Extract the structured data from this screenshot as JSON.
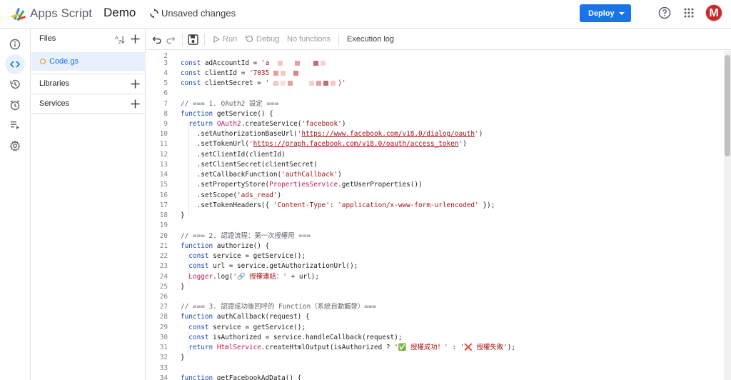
{
  "header": {
    "app_name": "Apps Script",
    "project_name": "Demo",
    "status": "Unsaved changes",
    "deploy_label": "Deploy",
    "avatar_letter": "M",
    "accent": "#1a73e8"
  },
  "rail": {
    "items": [
      {
        "name": "overview",
        "icon": "info-icon"
      },
      {
        "name": "editor",
        "icon": "code-icon",
        "active": true
      },
      {
        "name": "triggers-history",
        "icon": "history-icon"
      },
      {
        "name": "triggers",
        "icon": "alarm-icon"
      },
      {
        "name": "executions",
        "icon": "executions-icon"
      },
      {
        "name": "settings",
        "icon": "gear-icon"
      }
    ]
  },
  "files_panel": {
    "files_title": "Files",
    "file_name": "Code.gs",
    "libraries_title": "Libraries",
    "services_title": "Services"
  },
  "toolbar": {
    "run_label": "Run",
    "debug_label": "Debug",
    "function_select": "No functions",
    "execution_log_label": "Execution log"
  },
  "code": {
    "lines": [
      {
        "n": "2",
        "t": ""
      },
      {
        "n": "3",
        "t": "const adAccountId = 'a"
      },
      {
        "n": "4",
        "t": "const clientId = '7035"
      },
      {
        "n": "5",
        "t": "const clientSecret = '"
      },
      {
        "n": "6",
        "t": ""
      },
      {
        "n": "7",
        "t": "// === 1. OAuth2 設定 ==="
      },
      {
        "n": "8",
        "t": "function getService() {"
      },
      {
        "n": "9",
        "t": "  return OAuth2.createService('facebook')"
      },
      {
        "n": "10",
        "t": "    .setAuthorizationBaseUrl('https://www.facebook.com/v18.0/dialog/oauth')"
      },
      {
        "n": "11",
        "t": "    .setTokenUrl('https://graph.facebook.com/v18.0/oauth/access_token')"
      },
      {
        "n": "12",
        "t": "    .setClientId(clientId)"
      },
      {
        "n": "13",
        "t": "    .setClientSecret(clientSecret)"
      },
      {
        "n": "14",
        "t": "    .setCallbackFunction('authCallback')"
      },
      {
        "n": "15",
        "t": "    .setPropertyStore(PropertiesService.getUserProperties())"
      },
      {
        "n": "16",
        "t": "    .setScope('ads_read')"
      },
      {
        "n": "17",
        "t": "    .setTokenHeaders({ 'Content-Type': 'application/x-www-form-urlencoded' });"
      },
      {
        "n": "18",
        "t": "}"
      },
      {
        "n": "19",
        "t": ""
      },
      {
        "n": "20",
        "t": "// === 2. 認證流程：第一次授權用 ==="
      },
      {
        "n": "21",
        "t": "function authorize() {"
      },
      {
        "n": "22",
        "t": "  const service = getService();"
      },
      {
        "n": "23",
        "t": "  const url = service.getAuthorizationUrl();"
      },
      {
        "n": "24",
        "t": "  Logger.log('🔗 授權連結：' + url);"
      },
      {
        "n": "25",
        "t": "}"
      },
      {
        "n": "26",
        "t": ""
      },
      {
        "n": "27",
        "t": "// === 3. 認證成功後回呼的 Function（系統自動觸發）==="
      },
      {
        "n": "28",
        "t": "function authCallback(request) {"
      },
      {
        "n": "29",
        "t": "  const service = getService();"
      },
      {
        "n": "30",
        "t": "  const isAuthorized = service.handleCallback(request);"
      },
      {
        "n": "31",
        "t": "  return HtmlService.createHtmlOutput(isAuthorized ? '✅ 授權成功！' : '❌ 授權失敗');"
      },
      {
        "n": "32",
        "t": "}"
      },
      {
        "n": "33",
        "t": ""
      },
      {
        "n": "34",
        "t": "function getFacebookAdData() {"
      }
    ]
  }
}
